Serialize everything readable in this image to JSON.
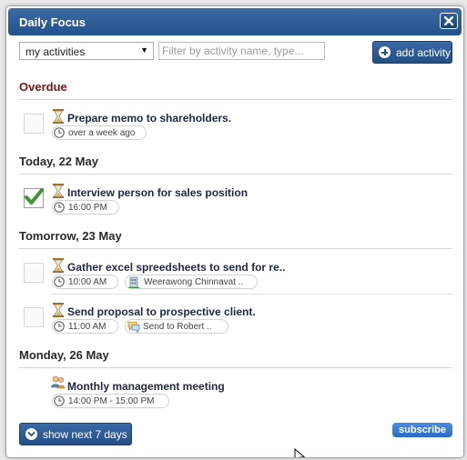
{
  "window": {
    "title": "Daily Focus"
  },
  "toolbar": {
    "filter_select": "my activities",
    "filter_placeholder": "Filter by activity name, type...",
    "add_label": "add activity"
  },
  "sections": {
    "overdue": "Overdue",
    "today": "Today, 22 May",
    "tomorrow": "Tomorrow, 23 May",
    "monday": "Monday, 26 May"
  },
  "activities": [
    {
      "title": "Prepare memo to shareholders.",
      "time": "over a week ago",
      "done": false,
      "icon": "hourglass-icon"
    },
    {
      "title": "Interview person for sales position",
      "time": "16:00 PM",
      "done": true,
      "icon": "hourglass-icon"
    },
    {
      "title": "Gather excel spreedsheets to send for re..",
      "time": "10:00 AM",
      "contact": "Weerawong Chinnavat ..",
      "contact_icon": "building-icon",
      "done": false,
      "icon": "hourglass-icon"
    },
    {
      "title": "Send proposal to prospective client.",
      "time": "11:00 AM",
      "contact": "Send to Robert ..",
      "contact_icon": "chat-icon",
      "done": false,
      "icon": "hourglass-icon"
    },
    {
      "title": "Monthly management meeting",
      "time": "14:00 PM - 15:00 PM",
      "icon": "people-icon"
    }
  ],
  "footer": {
    "show_next": "show next 7 days",
    "subscribe": "subscribe"
  },
  "colors": {
    "titlebar": "#24528c",
    "overdue": "#7a1414",
    "accent": "#2a6cc4"
  }
}
